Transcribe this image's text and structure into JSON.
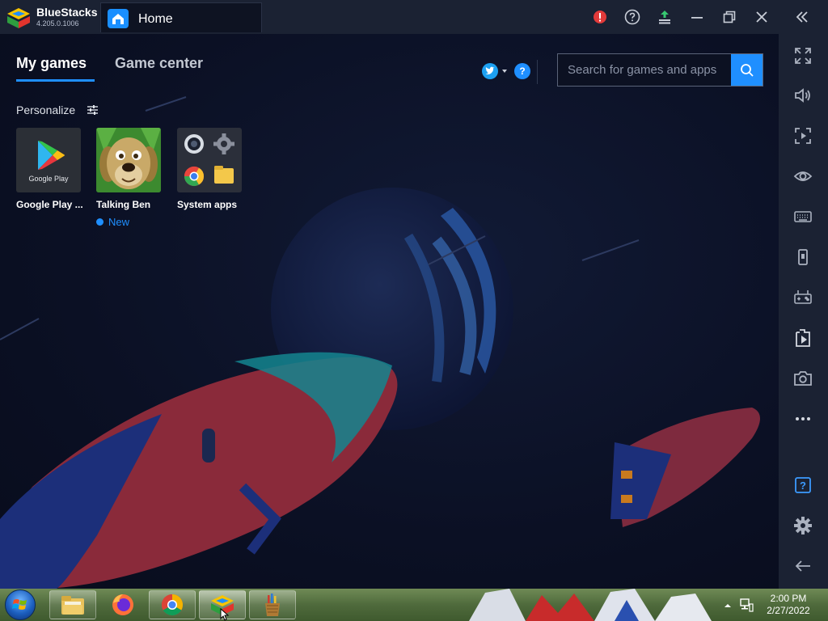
{
  "app": {
    "name": "BlueStacks",
    "version": "4.205.0.1006",
    "tab_label": "Home"
  },
  "titlebar": {
    "buttons": [
      "alert-icon",
      "help-icon",
      "update-icon",
      "minimize-icon",
      "restore-icon",
      "close-icon",
      "collapse-sidebar-icon"
    ]
  },
  "main": {
    "tabs": [
      {
        "label": "My games",
        "active": true
      },
      {
        "label": "Game center",
        "active": false
      }
    ],
    "help_label": "?",
    "search": {
      "placeholder": "Search for games and apps",
      "value": ""
    },
    "personalize_label": "Personalize",
    "apps": [
      {
        "name": "Google Play ...",
        "icon": "google-play-icon",
        "icon_caption": "Google Play"
      },
      {
        "name": "Talking Ben",
        "icon": "talking-ben-icon",
        "badge": "New"
      },
      {
        "name": "System apps",
        "icon": "system-apps-icon"
      }
    ]
  },
  "sidebar": {
    "items": [
      "fullscreen-icon",
      "volume-icon",
      "screen-record-icon",
      "eye-icon",
      "keyboard-icon",
      "shake-icon",
      "gamepad-icon",
      "install-apk-icon",
      "screenshot-icon",
      "more-icon",
      "help-icon",
      "settings-icon",
      "back-icon"
    ],
    "help_label": "?"
  },
  "taskbar": {
    "apps": [
      "file-explorer-icon",
      "firefox-icon",
      "chrome-icon",
      "bluestacks-icon",
      "pencil-cup-icon"
    ],
    "time": "2:00 PM",
    "date": "2/27/2022"
  },
  "colors": {
    "accent": "#1f8fff",
    "titlebar": "#1b2233",
    "background": "#0b1024"
  }
}
